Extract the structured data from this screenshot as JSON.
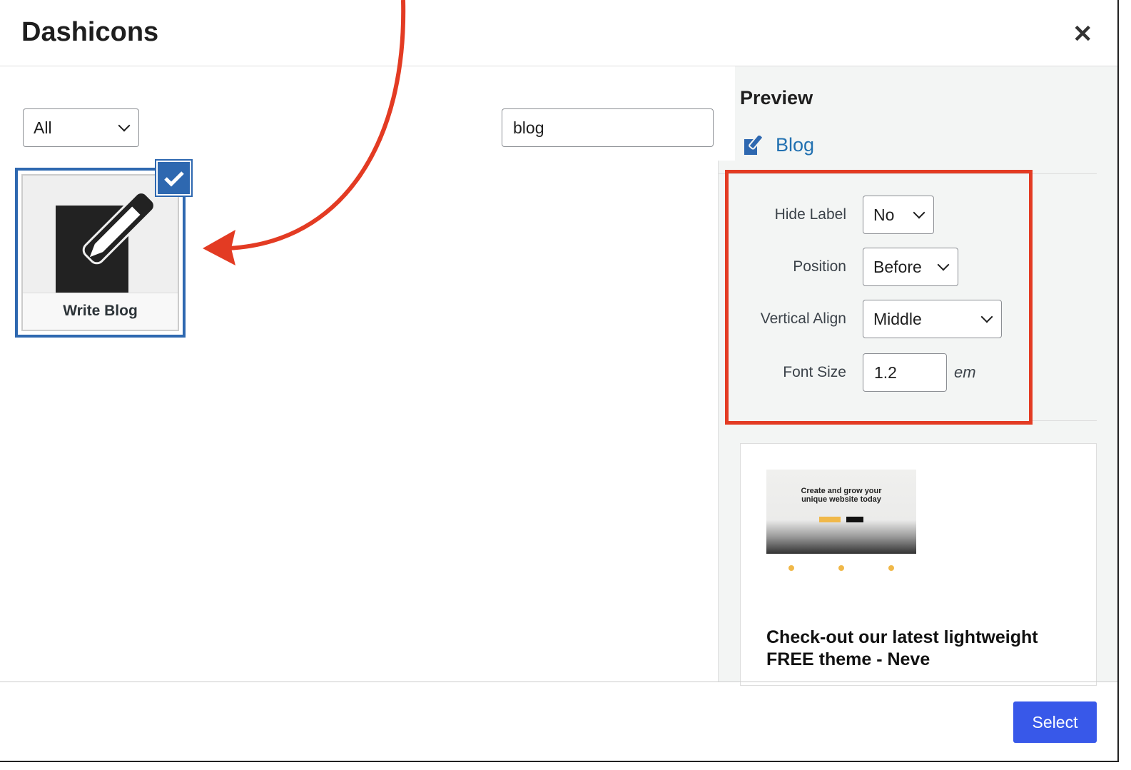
{
  "header": {
    "title": "Dashicons",
    "close_icon": "close-icon"
  },
  "filter": {
    "selected": "All"
  },
  "search": {
    "value": "blog"
  },
  "icon_grid": {
    "items": [
      {
        "label": "Write Blog",
        "icon": "edit-page-icon",
        "selected": true
      }
    ]
  },
  "preview": {
    "heading": "Preview",
    "label": "Blog",
    "icon": "edit-icon"
  },
  "settings": {
    "hide_label": {
      "label": "Hide Label",
      "value": "No"
    },
    "position": {
      "label": "Position",
      "value": "Before"
    },
    "vertical_align": {
      "label": "Vertical Align",
      "value": "Middle"
    },
    "font_size": {
      "label": "Font Size",
      "value": "1.2",
      "unit": "em"
    }
  },
  "promo": {
    "thumbnail_headline": "Create and grow your unique website today",
    "title": "Check-out our latest lightweight FREE theme - Neve"
  },
  "footer": {
    "select_label": "Select"
  },
  "colors": {
    "accent": "#3858e9",
    "selected_border": "#2e68b0",
    "annotation": "#e33b23"
  }
}
